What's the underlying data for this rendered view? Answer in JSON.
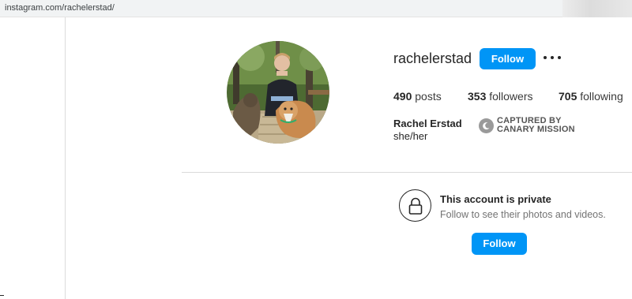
{
  "browser": {
    "url": "instagram.com/rachelerstad/"
  },
  "profile": {
    "username": "rachelerstad",
    "follow_label": "Follow",
    "posts_count": "490",
    "posts_label": "posts",
    "followers_count": "353",
    "followers_label": "followers",
    "following_count": "705",
    "following_label": "following",
    "full_name": "Rachel Erstad",
    "pronouns": "she/her"
  },
  "watermark": {
    "line1": "CAPTURED BY",
    "line2": "CANARY MISSION"
  },
  "private_notice": {
    "title": "This account is private",
    "subtitle": "Follow to see their photos and videos.",
    "follow_label": "Follow"
  },
  "icons": {
    "more": "more-options-icon",
    "lock": "lock-icon",
    "watermark": "canary-mission-icon"
  },
  "colors": {
    "accent": "#0095f6",
    "text": "#262626",
    "muted": "#737373",
    "divider": "#dbdbdb"
  }
}
